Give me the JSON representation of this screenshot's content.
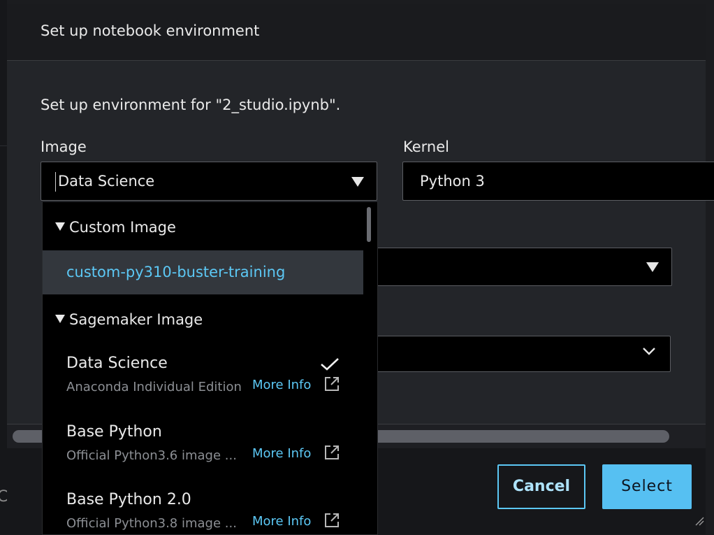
{
  "modal": {
    "title": "Set up notebook environment",
    "subtitle": "Set up environment for \"2_studio.ipynb\"."
  },
  "fields": {
    "image_label": "Image",
    "image_value": "Data Science",
    "kernel_label": "Kernel",
    "kernel_value": "Python 3"
  },
  "dropdown": {
    "groups": [
      {
        "label": "Custom Image",
        "items": [
          {
            "name": "custom-py310-buster-training",
            "highlighted": true
          }
        ]
      },
      {
        "label": "Sagemaker Image",
        "items": [
          {
            "name": "Data Science",
            "description": "Anaconda Individual Edition",
            "more_info": "More Info",
            "selected": true
          },
          {
            "name": "Base Python",
            "description": "Official Python3.6 image ...",
            "more_info": "More Info"
          },
          {
            "name": "Base Python 2.0",
            "description": "Official Python3.8 image ...",
            "more_info": "More Info"
          }
        ]
      }
    ]
  },
  "buttons": {
    "cancel": "Cancel",
    "select": "Select"
  },
  "background": {
    "partial_text": "C"
  },
  "icons": {
    "caret": "caret-down-icon",
    "chevron": "chevron-down-icon",
    "check": "check-icon",
    "external": "external-link-icon",
    "resize": "resize-handle-icon"
  },
  "colors": {
    "accent": "#5cc8f5",
    "primary_button": "#56c0f2",
    "dropdown_bg": "#000000",
    "highlight_row": "#33373d"
  }
}
